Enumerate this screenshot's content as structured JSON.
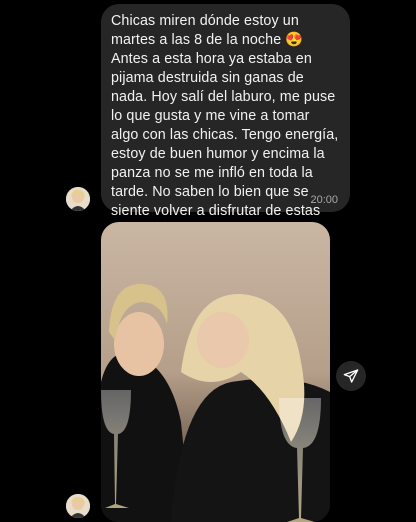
{
  "message": {
    "text": "Chicas miren dónde estoy un martes a las 8 de la noche 😍\nAntes a esta hora ya estaba en pijama destruida sin ganas de nada. Hoy salí del laburo, me puse lo que gusta y me vine a tomar algo con las chicas. Tengo energía, estoy de buen humor y encima la panza no se me infló en toda la tarde. No saben lo bien que se siente volver a disfrutar de estas cosas ❤️",
    "time": "20:00"
  },
  "icons": {
    "share": "paper-plane-icon",
    "avatar": "avatar"
  },
  "colors": {
    "background": "#000000",
    "bubble": "#262626",
    "text": "#f2f2f2",
    "timestamp": "#a8a8a8"
  }
}
